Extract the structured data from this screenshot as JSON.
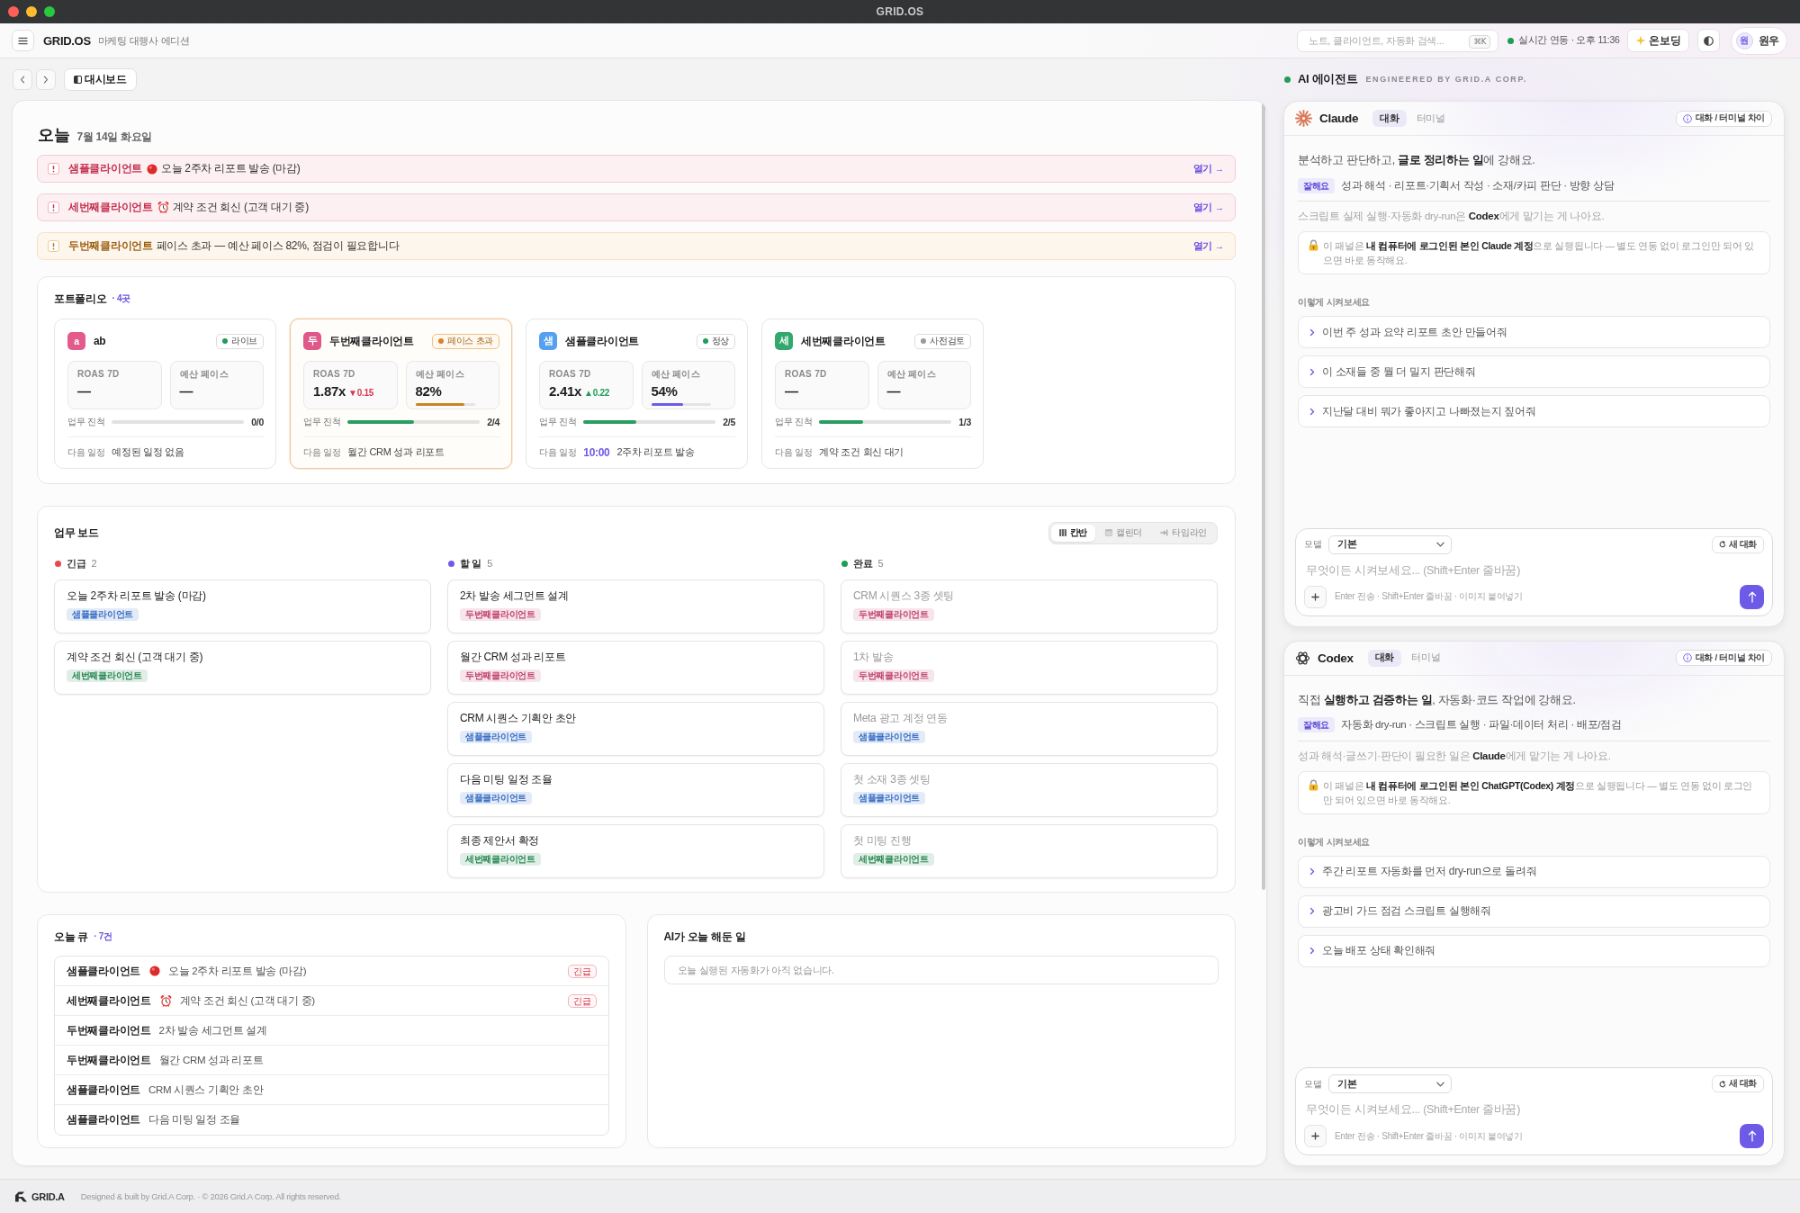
{
  "window": {
    "title": "GRID.OS"
  },
  "app_header": {
    "brand": "GRID.OS",
    "edition": "마케팅 대행사 에디션",
    "search": {
      "placeholder": "노트, 클라이언트, 자동화 검색...",
      "shortcut": "⌘K"
    },
    "sync_status": "실시간 연동 · 오후 11:36",
    "onboarding_button": "온보딩",
    "user": {
      "initial": "원",
      "name": "원우"
    }
  },
  "nav": {
    "current_tab": "대시보드"
  },
  "today": {
    "title": "오늘",
    "date": "7월 14일 화요일",
    "alerts": [
      {
        "urgent": true,
        "kind": "deadline",
        "client": "샘플클라이언트",
        "message": "오늘 2주차 리포트 발송 (마감)",
        "action": "열기 →"
      },
      {
        "urgent": true,
        "kind": "reminder",
        "client": "세번째클라이언트",
        "message": "계약 조건 회신 (고객 대기 중)",
        "action": "열기 →"
      },
      {
        "urgent": false,
        "kind": "pace",
        "client": "두번째클라이언트",
        "message": "페이스 초과 — 예산 페이스 82%, 점검이 필요합니다",
        "action": "열기 →"
      }
    ]
  },
  "portfolio": {
    "title": "포트폴리오",
    "count": "· 4곳",
    "clients": [
      {
        "avatar": "a",
        "color": "#e35a8c",
        "name": "ab",
        "highlighted": false,
        "status": {
          "label": "라이브",
          "color": "#1f9d55"
        },
        "roas": {
          "label": "ROAS 7D",
          "value": "—"
        },
        "pace": {
          "label": "예산 페이스",
          "value": "—"
        },
        "progress": {
          "label": "업무 진척",
          "count": "0/0"
        },
        "schedule": {
          "label": "다음 일정",
          "text": "예정된 일정 없음"
        }
      },
      {
        "avatar": "두",
        "color": "#e0578a",
        "name": "두번째클라이언트",
        "highlighted": true,
        "status": {
          "label": "페이스 초과",
          "color": "#d9822b"
        },
        "roas": {
          "label": "ROAS 7D",
          "value": "1.87x",
          "delta": "▼0.15",
          "up": false
        },
        "pace": {
          "label": "예산 페이스",
          "value": "82%",
          "level": 0.82,
          "color": "#c9841e"
        },
        "progress": {
          "label": "업무 진척",
          "level": 0.5,
          "count": "2/4"
        },
        "schedule": {
          "label": "다음 일정",
          "text": "월간 CRM 성과 리포트"
        }
      },
      {
        "avatar": "샘",
        "color": "#55a0f0",
        "name": "샘플클라이언트",
        "highlighted": false,
        "status": {
          "label": "정상",
          "color": "#1f9d55"
        },
        "roas": {
          "label": "ROAS 7D",
          "value": "2.41x",
          "delta": "▲0.22",
          "up": true
        },
        "pace": {
          "label": "예산 페이스",
          "value": "54%",
          "level": 0.54,
          "color": "#6d5ce8"
        },
        "progress": {
          "label": "업무 진척",
          "level": 0.4,
          "count": "2/5"
        },
        "schedule": {
          "label": "다음 일정",
          "time": "10:00",
          "text": "2주차 리포트 발송"
        }
      },
      {
        "avatar": "세",
        "color": "#33a86d",
        "name": "세번째클라이언트",
        "highlighted": false,
        "status": {
          "label": "사전검토",
          "color": "#9a9a9e"
        },
        "roas": {
          "label": "ROAS 7D",
          "value": "—"
        },
        "pace": {
          "label": "예산 페이스",
          "value": "—"
        },
        "progress": {
          "label": "업무 진척",
          "level": 0.333,
          "count": "1/3"
        },
        "schedule": {
          "label": "다음 일정",
          "text": "계약 조건 회신 대기"
        }
      }
    ]
  },
  "task_board": {
    "title": "업무 보드",
    "views": [
      {
        "label": "칸반",
        "kind": "kanban",
        "selected": true
      },
      {
        "label": "캘린더",
        "kind": "calendar",
        "selected": false
      },
      {
        "label": "타임라인",
        "kind": "timeline",
        "selected": false
      }
    ],
    "columns": [
      {
        "title": "긴급",
        "count": "2",
        "color": "#e5484d",
        "cards": [
          {
            "title": "오늘 2주차 리포트 발송 (마감)",
            "done": false,
            "tag": {
              "label": "샘플클라이언트",
              "color": "#3b6fc6"
            }
          },
          {
            "title": "계약 조건 회신 (고객 대기 중)",
            "done": false,
            "tag": {
              "label": "세번째클라이언트",
              "color": "#2b8a55"
            }
          }
        ]
      },
      {
        "title": "할 일",
        "count": "5",
        "color": "#6e5ce6",
        "cards": [
          {
            "title": "2차 발송 세그먼트 설계",
            "done": false,
            "tag": {
              "label": "두번째클라이언트",
              "color": "#c2456e"
            }
          },
          {
            "title": "월간 CRM 성과 리포트",
            "done": false,
            "tag": {
              "label": "두번째클라이언트",
              "color": "#c2456e"
            }
          },
          {
            "title": "CRM 시퀀스 기획안 초안",
            "done": false,
            "tag": {
              "label": "샘플클라이언트",
              "color": "#3b6fc6"
            }
          },
          {
            "title": "다음 미팅 일정 조율",
            "done": false,
            "tag": {
              "label": "샘플클라이언트",
              "color": "#3b6fc6"
            }
          },
          {
            "title": "최종 제안서 확정",
            "done": false,
            "tag": {
              "label": "세번째클라이언트",
              "color": "#2b8a55"
            }
          }
        ]
      },
      {
        "title": "완료",
        "count": "5",
        "color": "#1f9d55",
        "cards": [
          {
            "title": "CRM 시퀀스 3종 셋팅",
            "done": true,
            "tag": {
              "label": "두번째클라이언트",
              "color": "#c2456e"
            }
          },
          {
            "title": "1차 발송",
            "done": true,
            "tag": {
              "label": "두번째클라이언트",
              "color": "#c2456e"
            }
          },
          {
            "title": "Meta 광고 계정 연동",
            "done": true,
            "tag": {
              "label": "샘플클라이언트",
              "color": "#3b6fc6"
            }
          },
          {
            "title": "첫 소재 3종 셋팅",
            "done": true,
            "tag": {
              "label": "샘플클라이언트",
              "color": "#3b6fc6"
            }
          },
          {
            "title": "첫 미팅 진행",
            "done": true,
            "tag": {
              "label": "세번째클라이언트",
              "color": "#2b8a55"
            }
          }
        ]
      }
    ]
  },
  "today_queue": {
    "title": "오늘 큐",
    "count": "· 7건",
    "rows": [
      {
        "client": "샘플클라이언트",
        "kind": "deadline",
        "task": "오늘 2주차 리포트 발송 (마감)",
        "badge": "긴급"
      },
      {
        "client": "세번째클라이언트",
        "kind": "reminder",
        "task": "계약 조건 회신 (고객 대기 중)",
        "badge": "긴급"
      },
      {
        "client": "두번째클라이언트",
        "kind": "task",
        "task": "2차 발송 세그먼트 설계"
      },
      {
        "client": "두번째클라이언트",
        "kind": "task",
        "task": "월간 CRM 성과 리포트"
      },
      {
        "client": "샘플클라이언트",
        "kind": "task",
        "task": "CRM 시퀀스 기획안 초안"
      },
      {
        "client": "샘플클라이언트",
        "kind": "task",
        "task": "다음 미팅 일정 조율"
      }
    ]
  },
  "ai_activity": {
    "title": "AI가 오늘 해둔 일",
    "empty_message": "오늘 실행된 자동화가 아직 없습니다."
  },
  "agents": {
    "title": "AI 에이전트",
    "subtitle": "ENGINEERED BY GRID.A CORP.",
    "panels": [
      {
        "kind": "claude",
        "name": "Claude",
        "tabs": [
          {
            "label": "대화",
            "selected": true
          },
          {
            "label": "터미널",
            "selected": false
          }
        ],
        "info_button": "대화 / 터미널 차이",
        "intro": "분석하고 판단하고, **글로 정리하는 일**에 강해요.",
        "strengths_badge": "잘해요",
        "strengths": "성과 해석 · 리포트·기획서 작성 · 소재/카피 판단 · 방향 상담",
        "handoff": "스크립트 실제 실행·자동화 dry-run은 **Codex**에게 맡기는 게 나아요.",
        "note": "이 패널은 **내 컴퓨터에 로그인된 본인 Claude 계정**으로 실행됩니다 — 별도 연동 없이 로그인만 되어 있으면 바로 동작해요.",
        "suggestions_title": "이렇게 시켜보세요",
        "suggestions": [
          "이번 주 성과 요약 리포트 초안 만들어줘",
          "이 소재들 중 뭘 더 밀지 판단해줘",
          "지난달 대비 뭐가 좋아지고 나빠졌는지 짚어줘"
        ],
        "composer": {
          "model_label": "모델",
          "model": "기본",
          "new_chat": "새 대화",
          "placeholder": "무엇이든 시켜보세요... (Shift+Enter 줄바꿈)",
          "hint": "Enter 전송 · Shift+Enter 줄바꿈 · 이미지 붙여넣기"
        }
      },
      {
        "kind": "codex",
        "name": "Codex",
        "tabs": [
          {
            "label": "대화",
            "selected": true
          },
          {
            "label": "터미널",
            "selected": false
          }
        ],
        "info_button": "대화 / 터미널 차이",
        "intro": "직접 **실행하고 검증하는 일**, 자동화·코드 작업에 강해요.",
        "strengths_badge": "잘해요",
        "strengths": "자동화 dry-run · 스크립트 실행 · 파일·데이터 처리 · 배포/점검",
        "handoff": "성과 해석·글쓰기·판단이 필요한 일은 **Claude**에게 맡기는 게 나아요.",
        "note": "이 패널은 **내 컴퓨터에 로그인된 본인 ChatGPT(Codex) 계정**으로 실행됩니다 — 별도 연동 없이 로그인만 되어 있으면 바로 동작해요.",
        "suggestions_title": "이렇게 시켜보세요",
        "suggestions": [
          "주간 리포트 자동화를 먼저 dry-run으로 돌려줘",
          "광고비 가드 점검 스크립트 실행해줘",
          "오늘 배포 상태 확인해줘"
        ],
        "composer": {
          "model_label": "모델",
          "model": "기본",
          "new_chat": "새 대화",
          "placeholder": "무엇이든 시켜보세요... (Shift+Enter 줄바꿈)",
          "hint": "Enter 전송 · Shift+Enter 줄바꿈 · 이미지 붙여넣기"
        }
      }
    ]
  },
  "footer": {
    "brand": "GRID.A",
    "text": "Designed & built by Grid.A Corp. · © 2026 Grid.A Corp. All rights reserved."
  }
}
